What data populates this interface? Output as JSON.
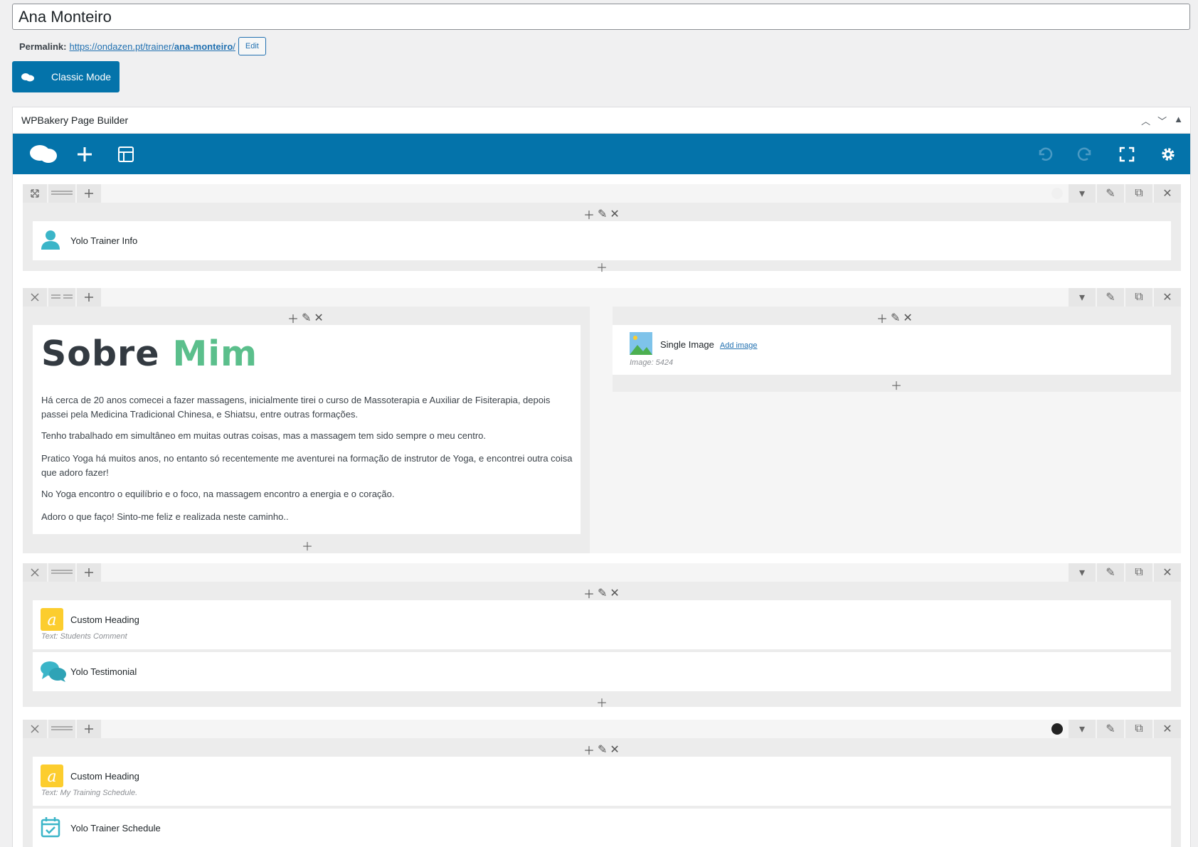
{
  "post_title": "Ana Monteiro",
  "permalink": {
    "label": "Permalink:",
    "base": "https://ondazen.pt/trainer/",
    "slug": "ana-monteiro",
    "trail": "/",
    "edit_label": "Edit"
  },
  "classic_mode_label": "Classic Mode",
  "panel": {
    "title": "WPBakery Page Builder"
  },
  "rows": [
    {
      "elements": [
        {
          "title": "Yolo Trainer Info",
          "icon": "person-icon"
        }
      ]
    },
    {
      "left_heading": {
        "part1": "Sobre",
        "part2": "Mim"
      },
      "paragraphs": [
        "Há cerca de 20 anos comecei a fazer massagens, inicialmente tirei o curso de Massoterapia e Auxiliar de Fisiterapia, depois passei pela Medicina Tradicional Chinesa, e Shiatsu, entre outras formações.",
        "Tenho trabalhado em simultâneo em muitas outras coisas, mas a massagem tem sido sempre o meu centro.",
        "Pratico Yoga há muitos anos, no entanto só recentemente me aventurei na formação de instrutor de Yoga, e encontrei outra coisa que adoro fazer!",
        "No Yoga encontro o equilíbrio e o foco, na massagem encontro a energia e o coração.",
        "Adoro o que faço! Sinto-me feliz e realizada neste caminho.."
      ],
      "right_element": {
        "title": "Single Image",
        "add_image": "Add image",
        "sub": "Image: 5424"
      }
    },
    {
      "elements": [
        {
          "title": "Custom Heading",
          "sub": "Text: Students Comment",
          "icon": "letter-a-icon"
        },
        {
          "title": "Yolo Testimonial",
          "icon": "chat-bubbles-icon"
        }
      ]
    },
    {
      "elements": [
        {
          "title": "Custom Heading",
          "sub": "Text: My Training Schedule.",
          "icon": "letter-a-icon"
        },
        {
          "title": "Yolo Trainer Schedule",
          "icon": "calendar-check-icon"
        }
      ]
    }
  ],
  "colors": {
    "accent": "#0473aa",
    "teal_icon": "#3bb5c8",
    "yellow_icon": "#fccd2e",
    "green_text": "#5bbf8c"
  }
}
